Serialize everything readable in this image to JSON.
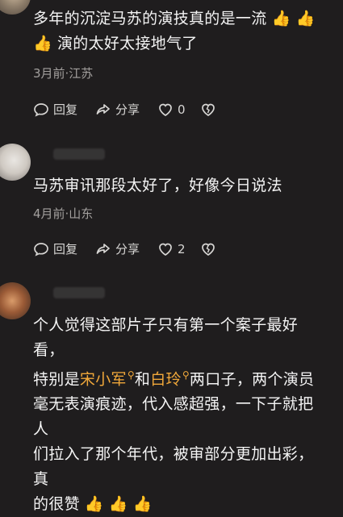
{
  "comment1": {
    "text": "多年的沉淀马苏的演技真的是一流",
    "line2": "演的太好太接地气了",
    "meta": "3月前·江苏",
    "reply_label": "回复",
    "share_label": "分享",
    "like_count": "0"
  },
  "comment2": {
    "text": "马苏审讯那段太好了，好像今日说法",
    "meta": "4月前·山东",
    "reply_label": "回复",
    "share_label": "分享",
    "like_count": "2"
  },
  "comment3": {
    "line1": "个人觉得这部片子只有第一个案子最好看，",
    "line2_prefix": "特别是",
    "name1": "宋小军",
    "line2_mid": "和",
    "name2": "白玲",
    "line2_suffix": "两口子，两个演员",
    "line3": "毫无表演痕迹，代入感超强，一下子就把人",
    "line4": "们拉入了那个年代，被审部分更加出彩，真",
    "line5": "的很赞"
  },
  "icons": {
    "reply": "comment-icon",
    "share": "share-icon",
    "like": "heart-icon",
    "dislike": "broken-heart-icon",
    "thumbs": "thumbs-up-icon"
  },
  "colors": {
    "highlight": "#f1a83a",
    "background": "#1f1d1e"
  }
}
